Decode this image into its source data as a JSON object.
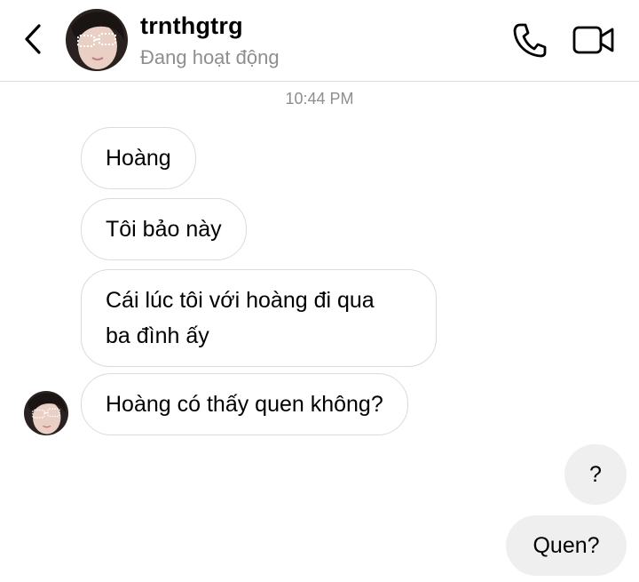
{
  "header": {
    "username": "trnthgtrg",
    "status": "Đang hoạt động",
    "icons": {
      "back": "chevron-left-icon",
      "call": "phone-icon",
      "video": "video-camera-icon"
    }
  },
  "thread": {
    "timestamp": "10:44 PM",
    "received": [
      "Hoàng",
      "Tôi bảo này",
      "Cái lúc tôi với hoàng đi qua\nba đình ấy",
      "Hoàng có thấy quen không?"
    ],
    "sent": [
      "?",
      "Quen?"
    ]
  },
  "colors": {
    "bubble_border": "#dbdbdb",
    "sent_bubble_bg": "#efefef",
    "secondary_text": "#8e8e8e"
  }
}
